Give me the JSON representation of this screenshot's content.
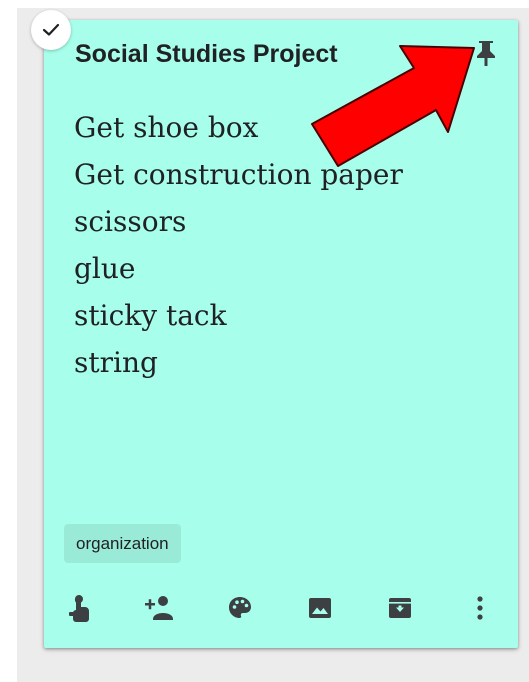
{
  "note": {
    "title": "Social Studies Project",
    "background_color": "#a7ffeb",
    "pinned": true,
    "items": [
      "Get shoe box",
      "Get construction paper",
      "scissors",
      "glue",
      "sticky tack",
      "string"
    ],
    "labels": [
      "organization"
    ]
  },
  "toolbar": {
    "actions": [
      {
        "icon": "remind-me-icon"
      },
      {
        "icon": "collaborator-icon"
      },
      {
        "icon": "palette-icon"
      },
      {
        "icon": "image-icon"
      },
      {
        "icon": "archive-icon"
      },
      {
        "icon": "more-icon"
      }
    ]
  },
  "overlay": {
    "annotation": "red-arrow-pointing-to-pin",
    "arrow_color": "#ff0000"
  }
}
